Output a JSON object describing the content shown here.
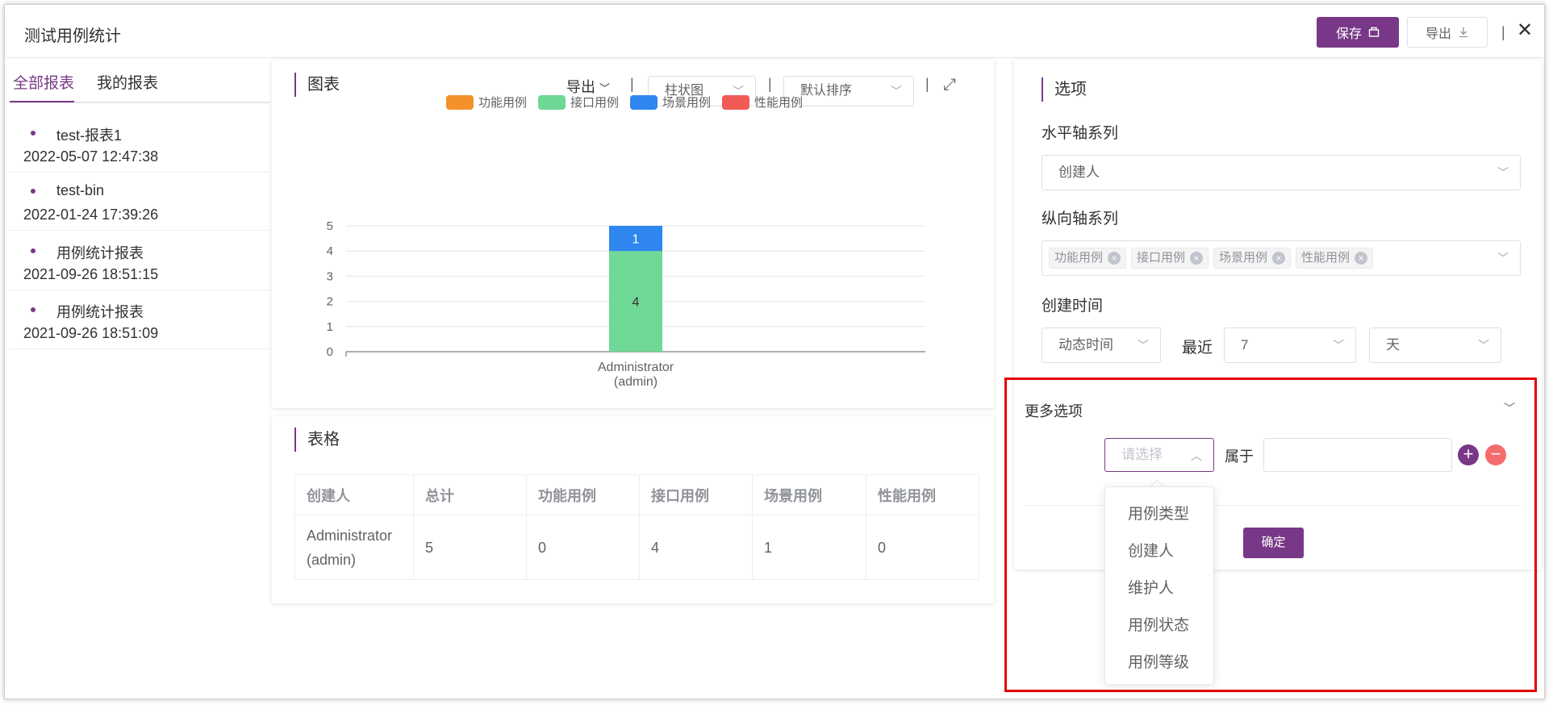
{
  "header": {
    "title": "测试用例统计",
    "save_label": "保存",
    "export_label": "导出",
    "separator": "|"
  },
  "sidebar": {
    "tabs": [
      {
        "label": "全部报表",
        "active": true
      },
      {
        "label": "我的报表",
        "active": false
      }
    ],
    "reports": [
      {
        "name": "test-报表1",
        "time": "2022-05-07 12:47:38"
      },
      {
        "name": "test-bin",
        "time": "2022-01-24 17:39:26"
      },
      {
        "name": "用例统计报表",
        "time": "2021-09-26 18:51:15"
      },
      {
        "name": "用例统计报表",
        "time": "2021-09-26 18:51:09"
      }
    ]
  },
  "chart_panel": {
    "title": "图表",
    "export_label": "导出",
    "separator": "|",
    "chart_type_value": "柱状图",
    "sort_value": "默认排序"
  },
  "chart_data": {
    "type": "bar",
    "stacked": true,
    "categories": [
      "Administrator\n(admin)"
    ],
    "series": [
      {
        "name": "功能用例",
        "color": "#f5912b",
        "values": [
          0
        ]
      },
      {
        "name": "接口用例",
        "color": "#6fd897",
        "values": [
          4
        ]
      },
      {
        "name": "场景用例",
        "color": "#2f86ef",
        "values": [
          1
        ]
      },
      {
        "name": "性能用例",
        "color": "#f25a55",
        "values": [
          0
        ]
      }
    ],
    "ylim": [
      0,
      5
    ],
    "yticks": [
      "0",
      "1",
      "2",
      "3",
      "4",
      "5"
    ],
    "grid": true,
    "legend": "top-center"
  },
  "table_panel": {
    "title": "表格",
    "columns": [
      "创建人",
      "总计",
      "功能用例",
      "接口用例",
      "场景用例",
      "性能用例"
    ],
    "rows": [
      [
        "Administrator\n(admin)",
        "5",
        "0",
        "4",
        "1",
        "0"
      ]
    ]
  },
  "options": {
    "title": "选项",
    "x_axis_label": "水平轴系列",
    "x_axis_value": "创建人",
    "y_axis_label": "纵向轴系列",
    "y_axis_tags": [
      "功能用例",
      "接口用例",
      "场景用例",
      "性能用例"
    ],
    "time_label": "创建时间",
    "time_mode": "动态时间",
    "recent_label": "最近",
    "recent_value": "7",
    "unit_value": "天",
    "more_label": "更多选项",
    "filter_placeholder": "请选择",
    "belongs_label": "属于",
    "confirm_label": "确定",
    "dropdown_options": [
      "用例类型",
      "创建人",
      "维护人",
      "用例状态",
      "用例等级"
    ]
  },
  "colors": {
    "accent": "#783887",
    "highlight": "#e50000",
    "minus": "#f56c6c"
  }
}
